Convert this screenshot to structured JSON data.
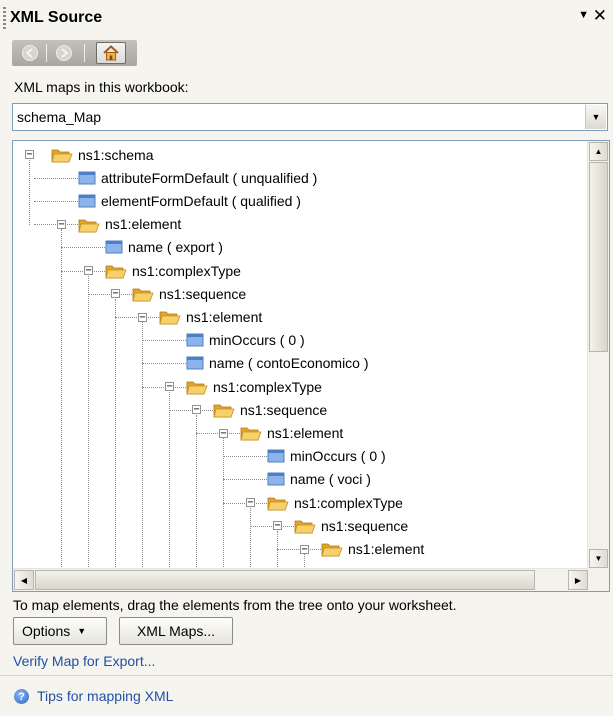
{
  "pane": {
    "title": "XML Source",
    "menu_arrow": "▼",
    "close": "✕"
  },
  "toolbar": {
    "back_icon": "arrow-left-icon",
    "forward_icon": "arrow-right-icon",
    "home_icon": "home-icon"
  },
  "maps": {
    "label": "XML maps in this workbook:",
    "selected": "schema_Map"
  },
  "tree": {
    "nodes": [
      {
        "label": "ns1:schema",
        "type": "folder",
        "depth": 0,
        "expander": "minus"
      },
      {
        "label": "attributeFormDefault ( unqualified )",
        "type": "attribute",
        "depth": 1
      },
      {
        "label": "elementFormDefault ( qualified )",
        "type": "attribute",
        "depth": 1
      },
      {
        "label": "ns1:element",
        "type": "folder",
        "depth": 1,
        "expander": "minus"
      },
      {
        "label": "name ( export )",
        "type": "attribute",
        "depth": 2
      },
      {
        "label": "ns1:complexType",
        "type": "folder",
        "depth": 2,
        "expander": "minus"
      },
      {
        "label": "ns1:sequence",
        "type": "folder",
        "depth": 3,
        "expander": "minus"
      },
      {
        "label": "ns1:element",
        "type": "folder",
        "depth": 4,
        "expander": "minus"
      },
      {
        "label": "minOccurs ( 0 )",
        "type": "attribute",
        "depth": 5
      },
      {
        "label": "name ( contoEconomico )",
        "type": "attribute",
        "depth": 5
      },
      {
        "label": "ns1:complexType",
        "type": "folder",
        "depth": 5,
        "expander": "minus"
      },
      {
        "label": "ns1:sequence",
        "type": "folder",
        "depth": 6,
        "expander": "minus"
      },
      {
        "label": "ns1:element",
        "type": "folder",
        "depth": 7,
        "expander": "minus"
      },
      {
        "label": "minOccurs ( 0 )",
        "type": "attribute",
        "depth": 8
      },
      {
        "label": "name ( voci )",
        "type": "attribute",
        "depth": 8
      },
      {
        "label": "ns1:complexType",
        "type": "folder",
        "depth": 8,
        "expander": "minus"
      },
      {
        "label": "ns1:sequence",
        "type": "folder",
        "depth": 9,
        "expander": "minus"
      },
      {
        "label": "ns1:element",
        "type": "folder",
        "depth": 10,
        "expander": "minus"
      }
    ]
  },
  "footer": {
    "instructions": "To map elements, drag the elements from the tree onto your worksheet.",
    "options_label": "Options",
    "xml_maps_label": "XML Maps...",
    "verify_link": "Verify Map for Export...",
    "tips_link": "Tips for mapping XML",
    "tips_icon": "help-icon"
  },
  "colors": {
    "folder": "#f2c24e",
    "attribute": "#6f9ddb",
    "link": "#1f4fa8"
  }
}
